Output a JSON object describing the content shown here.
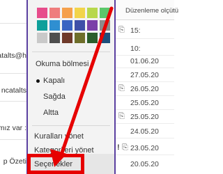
{
  "left_list": [
    "catalts@h",
    "ncatalts",
    "mız var :",
    "p Özeti"
  ],
  "menu": {
    "swatch_colors": [
      "#e74c8b",
      "#ef7d7d",
      "#f5a04b",
      "#f2d44a",
      "#b7d84c",
      "#5bc76a",
      "#0e9f9a",
      "#2f8fd1",
      "#3a63c2",
      "#3f4fa8",
      "#7b3fa8",
      "#8c8c8c",
      "#c9c9c9",
      "#4e4e4e",
      "#6f3a2a",
      "#6e6e2a",
      "#2b5d2b",
      "#1e4f7b"
    ],
    "reading_pane_title": "Okuma bölmesi",
    "reading_pane_options": [
      "Kapalı",
      "Sağda",
      "Altta"
    ],
    "manage_rules": "Kuralları yönet",
    "manage_categories": "Kategorileri yönet",
    "options": "Seçenekler"
  },
  "right": {
    "header": "Düzenleme olçütü",
    "dates": [
      "15:",
      "10:",
      "01.06.20",
      "27.05.20",
      "26.05.20",
      "25.05.20",
      "25.05.20",
      "24.05.20",
      "23.05.20",
      "20.05.20"
    ]
  },
  "colors": {
    "accent_purple": "#5a3fa0",
    "highlight_red": "#e60000"
  }
}
